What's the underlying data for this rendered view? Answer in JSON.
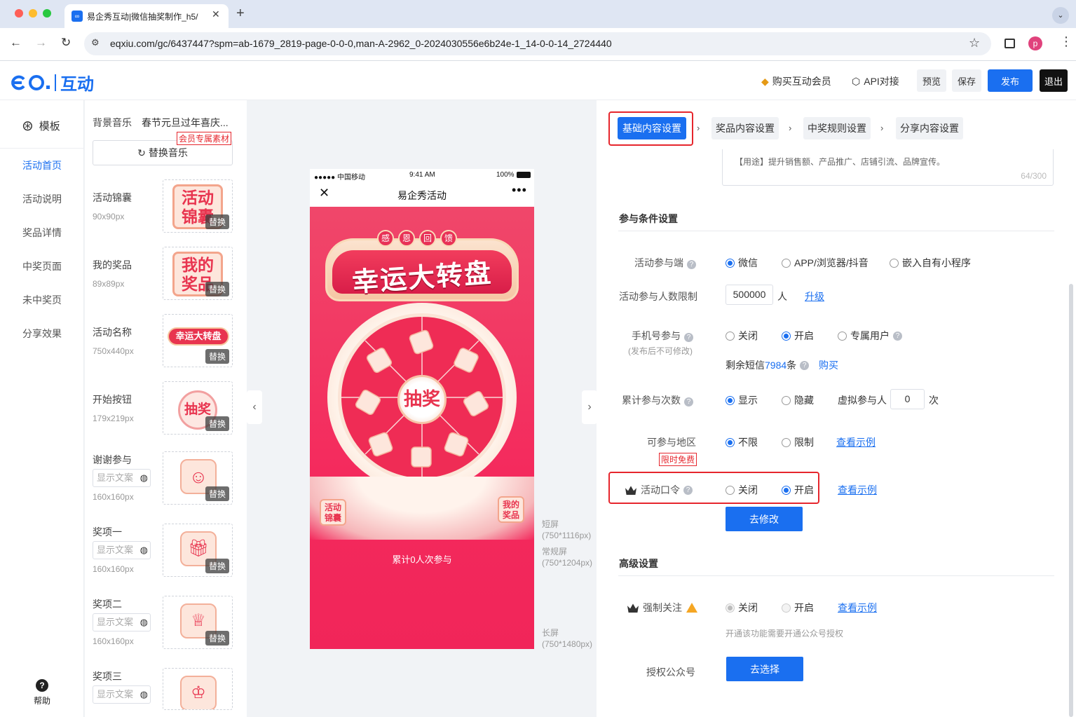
{
  "browser": {
    "tab_title": "易企秀互动|微信抽奖制作_h5/",
    "url": "eqxiu.com/gc/6437447?spm=ab-1679_2819-page-0-0-0,man-A-2962_0-2024030556e6b24e-1_14-0-0-14_2724440",
    "profile_initial": "p",
    "new_tab": "+"
  },
  "header": {
    "logo_text": "互动",
    "vip": "购买互动会员",
    "api": "API对接",
    "preview": "预览",
    "save": "保存",
    "publish": "发布",
    "exit": "退出"
  },
  "leftnav": {
    "template": "模板",
    "items": [
      "活动首页",
      "活动说明",
      "奖品详情",
      "中奖页面",
      "未中奖页",
      "分享效果"
    ],
    "help": "帮助"
  },
  "assets": {
    "music_label": "背景音乐",
    "music_name": "春节元旦过年喜庆...",
    "member_tag": "会员专属素材",
    "replace_music": "替换音乐",
    "replace": "替换",
    "show_text_placeholder": "显示文案",
    "items": [
      {
        "label": "活动锦囊",
        "size": "90x90px",
        "art": "活动\n锦囊"
      },
      {
        "label": "我的奖品",
        "size": "89x89px",
        "art": "我的\n奖品"
      },
      {
        "label": "活动名称",
        "size": "750x440px",
        "art": "幸运大转盘"
      },
      {
        "label": "开始按钮",
        "size": "179x219px",
        "art": "抽奖"
      },
      {
        "label": "谢谢参与",
        "size": "160x160px"
      },
      {
        "label": "奖项一",
        "size": "160x160px"
      },
      {
        "label": "奖项二",
        "size": "160x160px"
      },
      {
        "label": "奖项三",
        "size": ""
      }
    ]
  },
  "phone": {
    "carrier": "●●●●● 中国移动",
    "time": "9:41 AM",
    "battery": "100%",
    "title": "易企秀活动",
    "banner_top": [
      "感",
      "恩",
      "回",
      "馈"
    ],
    "banner_main": "幸运大转盘",
    "wheel_center": "抽奖",
    "tips_badge": "活动\n锦囊",
    "prize_badge": "我的\n奖品",
    "participants": "累计0人次参与"
  },
  "screen_marks": [
    {
      "name": "短屏",
      "size": "(750*1116px)"
    },
    {
      "name": "常规屏",
      "size": "(750*1204px)"
    },
    {
      "name": "长屏",
      "size": "(750*1480px)"
    }
  ],
  "steps": [
    "基础内容设置",
    "奖品内容设置",
    "中奖规则设置",
    "分享内容设置"
  ],
  "textarea": {
    "text": "【用途】提升销售额、产品推广、店铺引流、品牌宣传。",
    "count": "64/300"
  },
  "participation": {
    "section_title": "参与条件设置",
    "endpoint_label": "活动参与端",
    "endpoint_options": [
      "微信",
      "APP/浏览器/抖音",
      "嵌入自有小程序"
    ],
    "limit_label": "活动参与人数限制",
    "limit_value": "500000",
    "limit_unit": "人",
    "upgrade": "升级",
    "phone_label": "手机号参与",
    "phone_sub": "(发布后不可修改)",
    "phone_options": [
      "关闭",
      "开启",
      "专属用户"
    ],
    "sms_prefix": "剩余短信",
    "sms_count": "7984",
    "sms_suffix": "条",
    "buy": "购买",
    "count_label": "累计参与次数",
    "count_options": [
      "显示",
      "隐藏"
    ],
    "virtual_label": "虚拟参与人",
    "virtual_value": "0",
    "virtual_unit": "次",
    "region_label": "可参与地区",
    "region_options": [
      "不限",
      "限制"
    ],
    "region_free": "限时免费",
    "view_example": "查看示例",
    "password_label": "活动口令",
    "password_options": [
      "关闭",
      "开启"
    ],
    "modify_btn": "去修改"
  },
  "advanced": {
    "section_title": "高级设置",
    "follow_label": "强制关注",
    "follow_options": [
      "关闭",
      "开启"
    ],
    "view_example": "查看示例",
    "follow_hint": "开通该功能需要开通公众号授权",
    "auth_label": "授权公众号",
    "choose_btn": "去选择"
  },
  "colors": {
    "accent": "#1a6ff0",
    "highlight": "#e6262d",
    "phone_bg": "#f42a5d"
  }
}
